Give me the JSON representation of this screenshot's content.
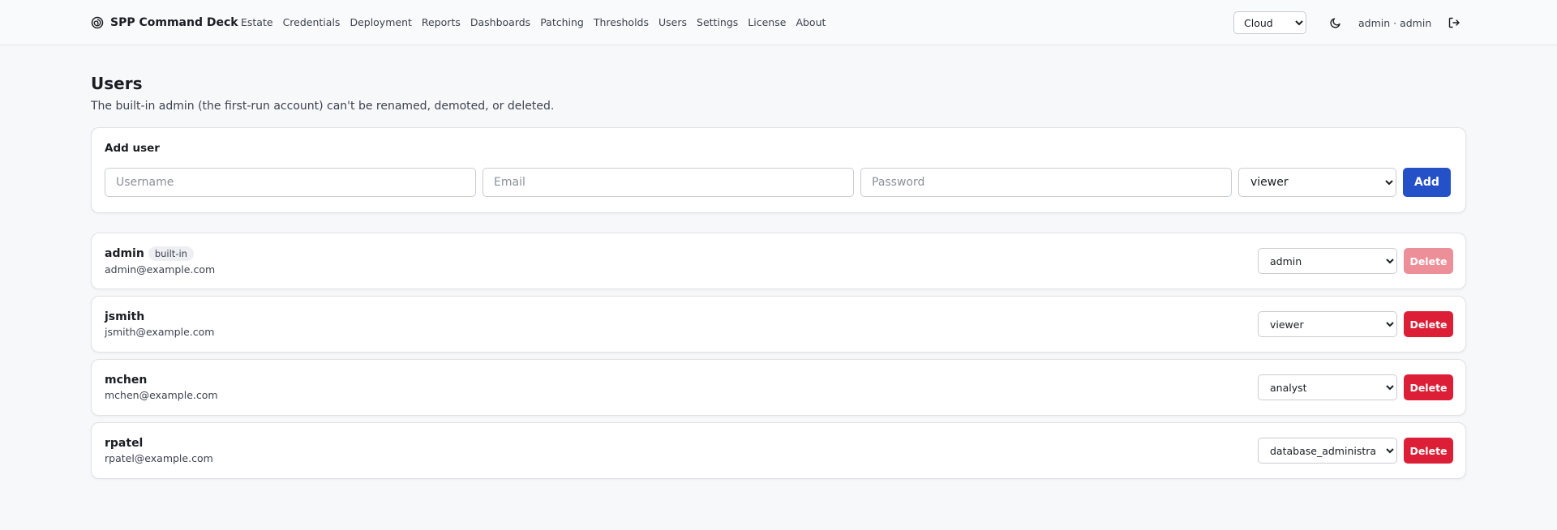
{
  "header": {
    "brand_icon": "spiral-logo-icon",
    "brand_name": "SPP Command Deck",
    "nav": [
      "Estate",
      "Credentials",
      "Deployment",
      "Reports",
      "Dashboards",
      "Patching",
      "Thresholds",
      "Users",
      "Settings",
      "License",
      "About"
    ],
    "environment": {
      "selected": "Cloud",
      "options": [
        "Cloud"
      ]
    },
    "theme_icon": "moon-icon",
    "user_label": "admin · admin",
    "logout_icon": "logout-icon"
  },
  "page": {
    "title": "Users",
    "subtitle": "The built-in admin (the first-run account) can't be renamed, demoted, or deleted."
  },
  "add_user": {
    "title": "Add user",
    "username_placeholder": "Username",
    "email_placeholder": "Email",
    "password_placeholder": "Password",
    "role_selected": "viewer",
    "role_options": [
      "viewer"
    ],
    "add_label": "Add"
  },
  "users": [
    {
      "name": "admin",
      "badge": "built-in",
      "email": "admin@example.com",
      "role": "admin",
      "delete_label": "Delete",
      "delete_disabled": true
    },
    {
      "name": "jsmith",
      "badge": "",
      "email": "jsmith@example.com",
      "role": "viewer",
      "delete_label": "Delete",
      "delete_disabled": false
    },
    {
      "name": "mchen",
      "badge": "",
      "email": "mchen@example.com",
      "role": "analyst",
      "delete_label": "Delete",
      "delete_disabled": false
    },
    {
      "name": "rpatel",
      "badge": "",
      "email": "rpatel@example.com",
      "role": "database_administrator",
      "delete_label": "Delete",
      "delete_disabled": false
    }
  ],
  "colors": {
    "primary": "#2450c8",
    "danger": "#dc1f36",
    "danger_disabled": "#ec8f99",
    "background": "#f7f8fa"
  }
}
